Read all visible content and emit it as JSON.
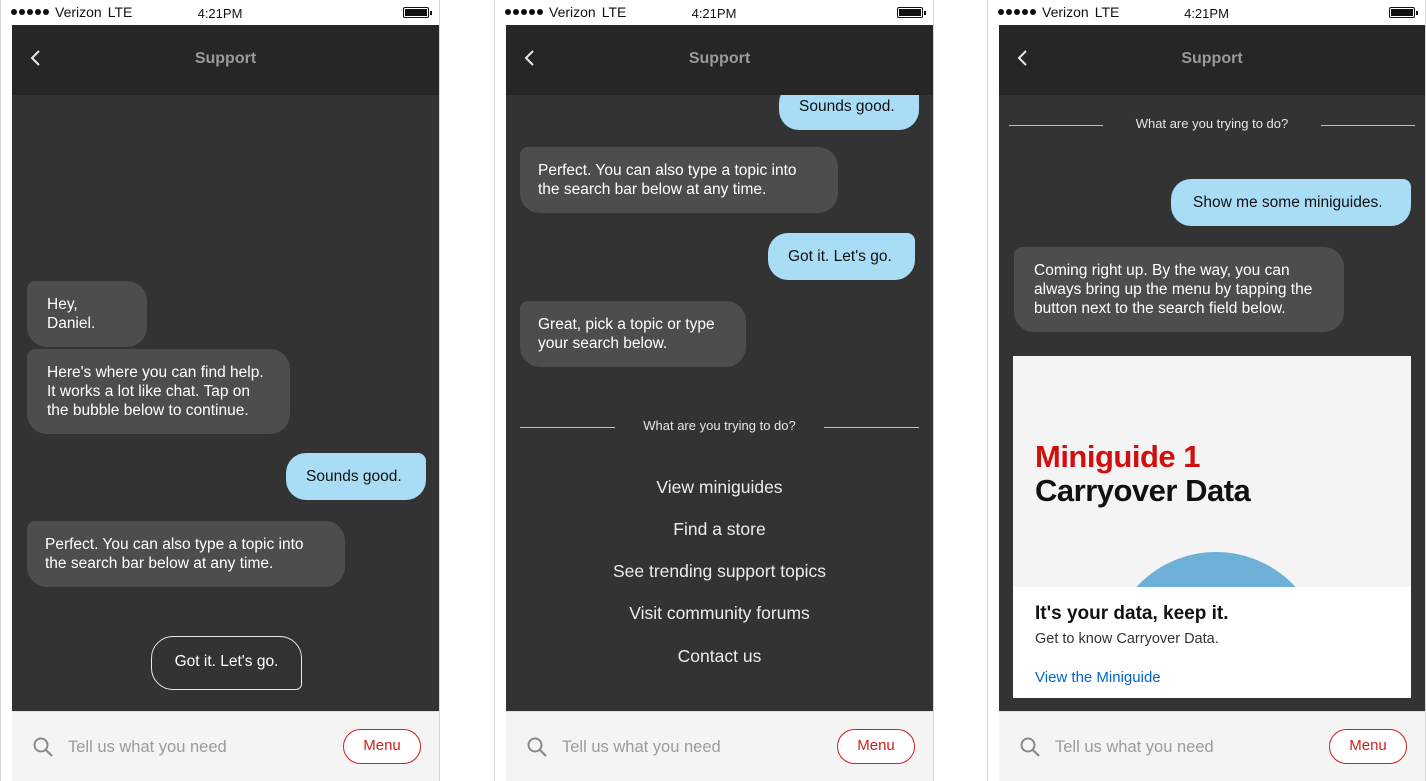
{
  "status": {
    "carrier": "Verizon",
    "network": "LTE",
    "time": "4:21PM"
  },
  "navbar": {
    "title": "Support"
  },
  "search": {
    "placeholder": "Tell us what you need",
    "menu_label": "Menu"
  },
  "screen1": {
    "msg1": "Hey, Daniel.",
    "msg2": "Here's where you can find help. It works a lot like chat. Tap on the bubble below to continue.",
    "msg3": "Sounds good.",
    "msg4": "Perfect. You can also type a topic into the search bar below at any time.",
    "cta": "Got it. Let's go."
  },
  "screen2": {
    "msg1": "Sounds good.",
    "msg2": "Perfect. You can also type a topic into the search bar below at any time.",
    "msg3": "Got it. Let's go.",
    "msg4": "Great, pick a topic or type your search below.",
    "divider": "What are you trying to do?",
    "options": [
      "View miniguides",
      "Find a store",
      "See trending support topics",
      "Visit community forums",
      "Contact us"
    ]
  },
  "screen3": {
    "divider": "What are you trying to do?",
    "msg1": "Show me some miniguides.",
    "msg2": "Coming right up. By the way, you can always bring up the menu by tapping the button next to the search field below.",
    "card": {
      "kicker": "Miniguide 1",
      "headline": "Carryover Data",
      "title": "It's your data, keep it.",
      "subtitle": "Get to know Carryover Data.",
      "link": "View the Miniguide"
    }
  }
}
